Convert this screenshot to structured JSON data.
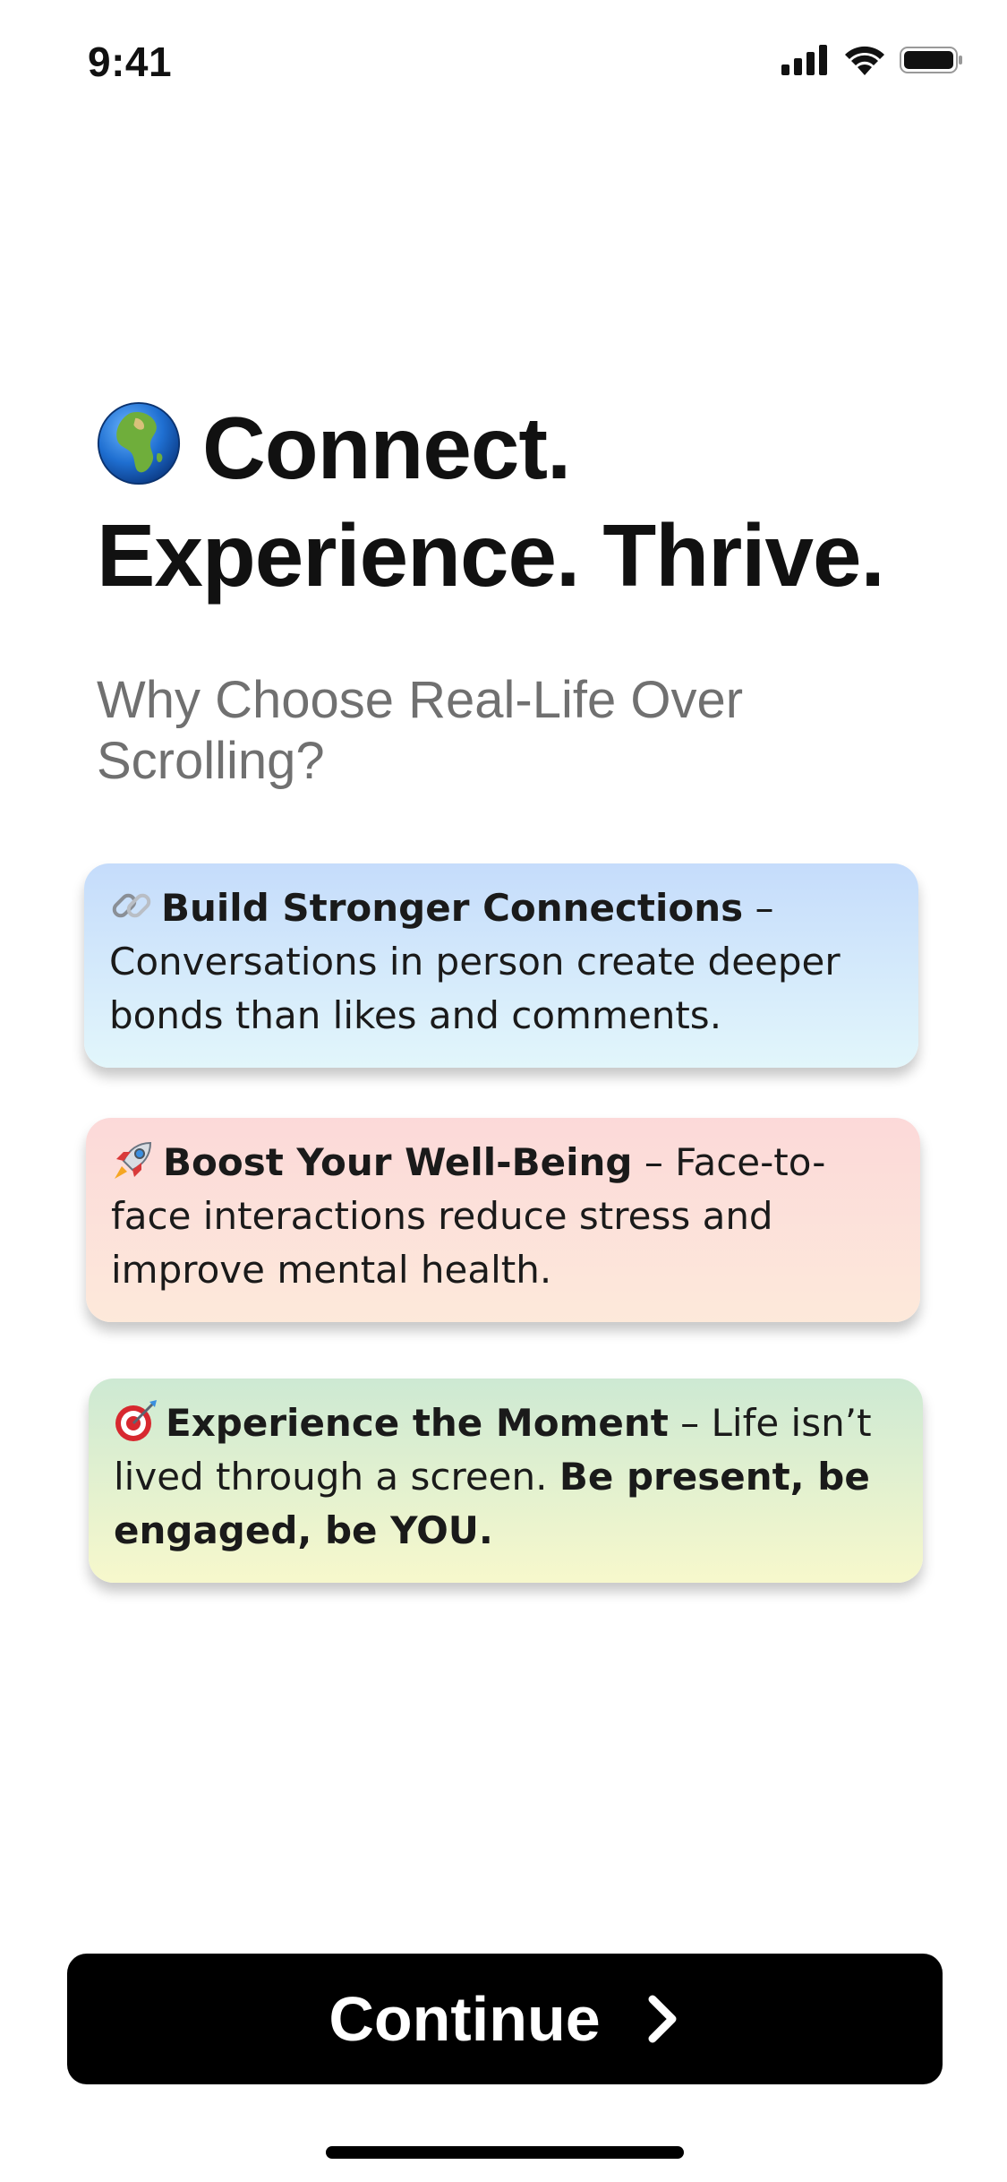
{
  "status_bar": {
    "time": "9:41",
    "icons": [
      "cellular-signal-icon",
      "wifi-icon",
      "battery-icon"
    ]
  },
  "headline": {
    "icon": "globe-icon",
    "line1": "Connect.",
    "line2": "Experience. Thrive."
  },
  "subtitle": "Why Choose Real-Life Over Scrolling?",
  "cards": [
    {
      "icon": "link-icon",
      "title": "Build Stronger Connections",
      "separator": " – ",
      "body": "Conversations in person create deeper bonds than likes and comments.",
      "gradient": [
        "#c5dcfb",
        "#e2f6fb"
      ]
    },
    {
      "icon": "rocket-icon",
      "title": "Boost Your Well-Being",
      "separator": " – ",
      "body": "Face-to-face interactions reduce stress and improve mental health.",
      "gradient": [
        "#fcd9d9",
        "#fde9da"
      ]
    },
    {
      "icon": "target-icon",
      "title": "Experience the Moment",
      "separator": " – ",
      "body": "Life isn’t lived through a screen. ",
      "emphasis": "Be present, be engaged, be YOU.",
      "gradient": [
        "#cde9d3",
        "#f7f8cc"
      ]
    }
  ],
  "continue_button": {
    "label": "Continue",
    "icon": "chevron-right-icon",
    "background": "#000000",
    "text_color": "#ffffff"
  }
}
